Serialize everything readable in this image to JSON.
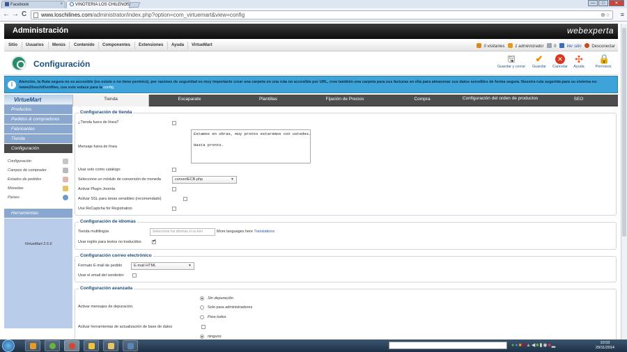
{
  "browser": {
    "tabs": [
      {
        "label": "Facebook",
        "close": "×"
      },
      {
        "label": "VINOTERIA LOS CHILENOS",
        "close": "×"
      }
    ],
    "url_host": "www.loschilines.com",
    "url_path": "/administrator/index.php?option=com_virtuemart&view=config",
    "back": "←",
    "forward": "→",
    "reload": "C",
    "zoom_star": "⊕☆",
    "menu": "≡",
    "window_min": "—",
    "window_max": "□",
    "window_close": "✕"
  },
  "admin": {
    "title": "Administración",
    "logo": "webexperta"
  },
  "menu": {
    "items": [
      "Sitio",
      "Usuarios",
      "Menús",
      "Contenido",
      "Componentes",
      "Extensiones",
      "Ayuda",
      "VirtueMart"
    ],
    "visitors": "0 visitantes",
    "admins": "1 administrador",
    "messages": "0",
    "view_site": "Ver sitio",
    "logout": "Desconectar"
  },
  "toolbar": {
    "title": "Configuración",
    "save_close": "Guardar y cerrar",
    "save": "Guardar",
    "cancel": "Cancelar",
    "help": "Ayuda",
    "permissions": "Permisos"
  },
  "notice": {
    "text": "Atención, la Ruta segura no es accesible (no existe o no tiene permiso), por razones de seguridad es muy importante crear una carpeta en una ruta no accesible por URL, cree también una carpeta para sus facturas en ella para almacenar sus datos sensibles de forma segura. Nuestra ruta sugerida para su sistema es: /www2/loschil/vmfiles, use este enlace para la",
    "link": "config"
  },
  "sidebar": {
    "logo": "VirtueMart",
    "groups": [
      "Productos",
      "Pedidos & compradores",
      "Fabricantes",
      "Tienda",
      "Configuración"
    ],
    "sub_items": [
      "Configuración",
      "Campos de comprador",
      "Estados de pedidos",
      "Monedas",
      "Países"
    ],
    "tools": "Herramientas",
    "version": "VirtueMart 2.6.6"
  },
  "tabs": [
    {
      "label": "Tienda"
    },
    {
      "label": "Escaparate"
    },
    {
      "label": "Plantillas"
    },
    {
      "label": "Fijación de Precios"
    },
    {
      "label": "Compra"
    },
    {
      "label": "Configuración del orden de productos"
    },
    {
      "label": "SEO"
    }
  ],
  "store_config": {
    "legend": "Configuración de tienda",
    "offline": "¿Tienda fuera de línea?",
    "offline_msg_label": "Mensaje fuera de línea",
    "offline_msg": "Estamos en obras, muy pronto estaremos con ustedes.\n\nHasta pronto.",
    "catalog_only": "Usar solo como catalogo",
    "currency_module_label": "Seleccione un módulo de conversión de moneda",
    "currency_module": "convertECB.php",
    "joomla_plugin": "Activar Plugin Joomla",
    "ssl": "Activar SSL para áreas sensibles (recomendado)",
    "recaptcha": "Use ReCaptcha for Registration"
  },
  "lang_config": {
    "legend": "Configuración de idiomas",
    "multilingual": "Tienda multilingüe",
    "placeholder": "Seleccione los idiomas si su tien",
    "more_languages": "More languages here",
    "translations_link": "Translations",
    "english_fallback": "Usar inglés para textos no traducidos"
  },
  "email_config": {
    "legend": "Configuración correo electrónico",
    "format_label": "Formato E-mail de pedido",
    "format": "E-mail HTML",
    "vendor_email": "Usar el email del vendedor"
  },
  "advanced_config": {
    "legend": "Configuración avanzada",
    "debug_label": "Activar mensajes de depuración.",
    "debug_options": [
      "Sin depuración.",
      "Solo para administradores",
      "Para todos"
    ],
    "update_tools": "Activar herramientas de actualización de base de datos",
    "next_option": "ninguno"
  },
  "taskbar": {
    "time": "10:03",
    "date": "29/11/2014"
  },
  "colors": {
    "notice": "#3ea3d8",
    "sidebar_group": "#8aa8cf",
    "title_blue": "#1a4f80"
  }
}
